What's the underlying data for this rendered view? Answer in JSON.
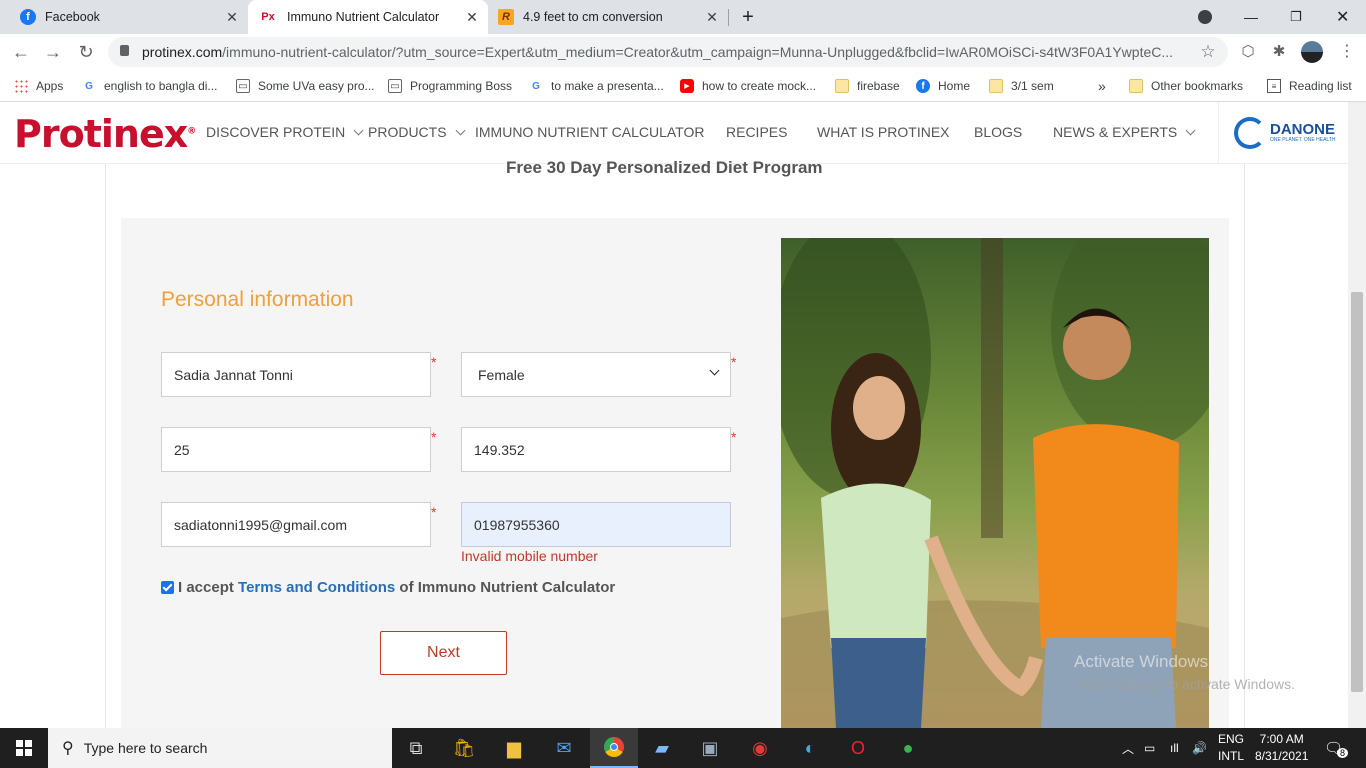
{
  "browser": {
    "tabs": [
      {
        "title": "Facebook",
        "icon": "facebook-icon",
        "color": "#1877f2"
      },
      {
        "title": "Immuno Nutrient Calculator",
        "icon": "protinex-favicon",
        "color": "#c8102e",
        "favicon_text": "Px"
      },
      {
        "title": "4.9 feet to cm conversion",
        "icon": "r-favicon",
        "color": "#f5a623",
        "favicon_text": "R"
      }
    ],
    "url_host": "protinex.com",
    "url_rest": "/immuno-nutrient-calculator/?utm_source=Expert&utm_medium=Creator&utm_campaign=Munna-Unplugged&fbclid=IwAR0MOiSCi-s4tW3F0A1YwpteC...",
    "bookmarks": [
      {
        "label": "Apps",
        "icon": "apps-grid-icon"
      },
      {
        "label": "english to bangla di...",
        "icon": "google-icon"
      },
      {
        "label": "Some UVa easy pro...",
        "icon": "site-icon"
      },
      {
        "label": "Programming Boss",
        "icon": "site-icon"
      },
      {
        "label": "to make a presenta...",
        "icon": "google-icon"
      },
      {
        "label": "how to create mock...",
        "icon": "youtube-icon"
      },
      {
        "label": "firebase",
        "icon": "folder-icon"
      },
      {
        "label": "Home",
        "icon": "facebook-icon"
      },
      {
        "label": "3/1 sem",
        "icon": "folder-icon"
      }
    ],
    "more_bookmarks": "»",
    "other_bookmarks": "Other bookmarks",
    "reading_list": "Reading list"
  },
  "site": {
    "logo": "Protinex",
    "nav": [
      {
        "label": "DISCOVER PROTEIN",
        "dropdown": true
      },
      {
        "label": "PRODUCTS",
        "dropdown": true
      },
      {
        "label": "IMMUNO NUTRIENT CALCULATOR",
        "dropdown": false
      },
      {
        "label": "RECIPES",
        "dropdown": false
      },
      {
        "label": "WHAT IS PROTINEX",
        "dropdown": false
      },
      {
        "label": "BLOGS",
        "dropdown": false
      },
      {
        "label": "NEWS & EXPERTS",
        "dropdown": true
      }
    ],
    "partner_logo": "DANONE",
    "partner_tagline": "ONE PLANET. ONE HEALTH",
    "banner": "Free 30 Day Personalized Diet Program",
    "brand_color": "#c8102e"
  },
  "form": {
    "section_title": "Personal information",
    "name": "Sadia Jannat Tonni",
    "gender": "Female",
    "age": "25",
    "height": "149.352",
    "email": "sadiatonni1995@gmail.com",
    "mobile": "01987955360",
    "mobile_error": "Invalid mobile number",
    "required_mark": "*",
    "terms_checked": true,
    "terms_prefix": "I accept ",
    "terms_link": "Terms and Conditions",
    "terms_suffix": " of Immuno Nutrient Calculator",
    "next_label": "Next"
  },
  "watermark": {
    "line1": "Activate Windows",
    "line2": "Go to Settings to activate Windows."
  },
  "taskbar": {
    "search_placeholder": "Type here to search",
    "lang_top": "ENG",
    "lang_bottom": "INTL",
    "time": "7:00 AM",
    "date": "8/31/2021",
    "notifications": "8"
  }
}
